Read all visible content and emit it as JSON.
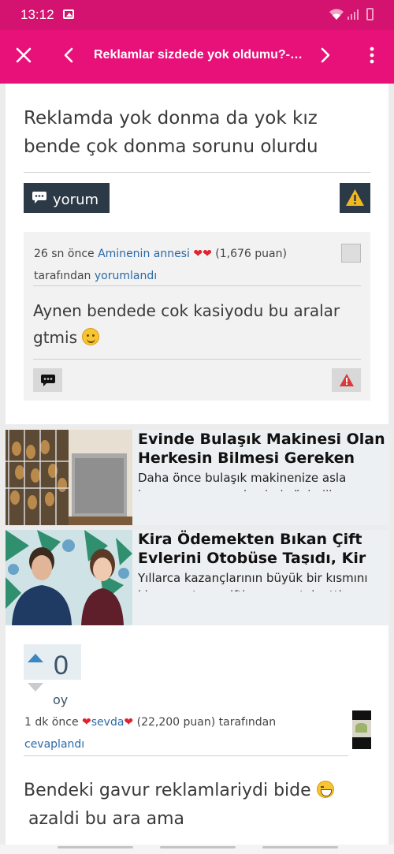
{
  "status_bar": {
    "time": "13:12"
  },
  "toolbar": {
    "title": "Reklamlar sizdede yok oldumu?-D...",
    "accent": "#e8117a"
  },
  "question": {
    "title": "Reklamda yok donma da yok kız bende çok donma sorunu olurdu"
  },
  "actions": {
    "comment_label": "yorum"
  },
  "comment": {
    "time": "26 sn önce",
    "author": "Aminenin annesi",
    "author_hearts": "❤❤",
    "points": "(1,676 puan)",
    "by": "tarafından",
    "action": "yorumlandı",
    "body": "Aynen bendede cok kasiyodu  bu aralar gtmis"
  },
  "ads": [
    {
      "headline": "Evinde Bulaşık Makinesi Olan Herkesin Bilmesi Gereken",
      "description": "Daha önce bulaşık makinenize asla koymamanız gerekenleri söyledik"
    },
    {
      "headline": "Kira Ödemekten Bıkan Çift Evlerini Otobüse Taşıdı, Kir",
      "description": "Yıllarca kazançlarının büyük bir kısmını kiraya yatıran çiftin canına tak etti ve"
    }
  ],
  "answer": {
    "votes": "0",
    "votes_label": "oy",
    "time": "1 dk önce",
    "author": "sevda",
    "heart": "❤",
    "points": "(22,200 puan)",
    "by": "tarafından",
    "action": "cevaplandı",
    "body": "Bendeki gavur reklamlariydi bide",
    "body2": "azaldi bu ara ama"
  }
}
